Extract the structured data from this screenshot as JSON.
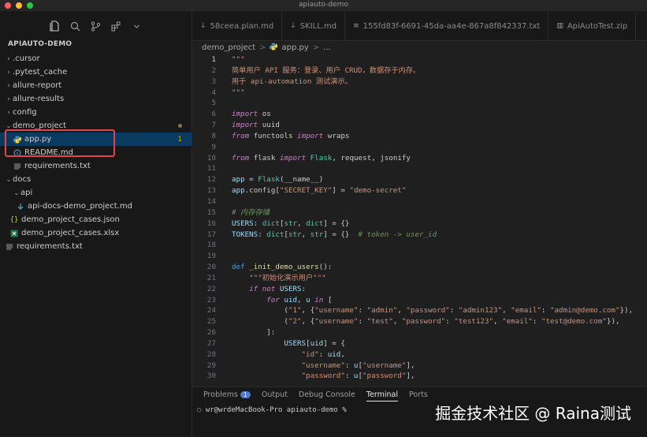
{
  "window": {
    "title": "apiauto-demo"
  },
  "toolbar": {
    "icons": [
      "files-icon",
      "search-icon",
      "source-control-icon",
      "extensions-icon",
      "chevron-down-icon"
    ]
  },
  "sidebar": {
    "project_title": "APIAUTO-DEMO",
    "items": [
      {
        "label": ".cursor",
        "kind": "folder",
        "expanded": false
      },
      {
        "label": ".pytest_cache",
        "kind": "folder",
        "expanded": false
      },
      {
        "label": "allure-report",
        "kind": "folder",
        "expanded": false
      },
      {
        "label": "allure-results",
        "kind": "folder",
        "expanded": false
      },
      {
        "label": "config",
        "kind": "folder",
        "expanded": false
      },
      {
        "label": "demo_project",
        "kind": "folder",
        "expanded": true
      },
      {
        "label": "app.py",
        "kind": "python",
        "badge": "1"
      },
      {
        "label": "README.md",
        "kind": "info"
      },
      {
        "label": "requirements.txt",
        "kind": "text"
      },
      {
        "label": "docs",
        "kind": "folder",
        "expanded": true
      },
      {
        "label": "api",
        "kind": "folder",
        "expanded": true
      },
      {
        "label": "api-docs-demo_project.md",
        "kind": "markdown"
      },
      {
        "label": "demo_project_cases.json",
        "kind": "json"
      },
      {
        "label": "demo_project_cases.xlsx",
        "kind": "excel"
      },
      {
        "label": "requirements.txt",
        "kind": "text"
      }
    ]
  },
  "tabs": [
    {
      "label": "58ceea.plan.md"
    },
    {
      "label": "SKILL.md"
    },
    {
      "label": "155fd83f-6691-45da-aa4e-867a8f842337.txt"
    },
    {
      "label": "ApiAutoTest.zip"
    }
  ],
  "breadcrumb": {
    "folder": "demo_project",
    "sep": ">",
    "file": "app.py",
    "rest": "..."
  },
  "editor": {
    "lines": [
      {
        "n": "1",
        "t": "\"\"\""
      },
      {
        "n": "2",
        "t": "简单用户 API 服务：登录、用户 CRUD，数据存于内存。"
      },
      {
        "n": "3",
        "t": "用于 api-automation 测试演示。"
      },
      {
        "n": "4",
        "t": "\"\"\""
      },
      {
        "n": "5",
        "t": ""
      },
      {
        "n": "6",
        "t": "import os"
      },
      {
        "n": "7",
        "t": "import uuid"
      },
      {
        "n": "8",
        "t": "from functools import wraps"
      },
      {
        "n": "9",
        "t": ""
      },
      {
        "n": "10",
        "t": "from flask import Flask, request, jsonify"
      },
      {
        "n": "11",
        "t": ""
      },
      {
        "n": "12",
        "t": "app = Flask(__name__)"
      },
      {
        "n": "13",
        "t": "app.config[\"SECRET_KEY\"] = \"demo-secret\""
      },
      {
        "n": "14",
        "t": ""
      },
      {
        "n": "15",
        "t": "# 内存存储"
      },
      {
        "n": "16",
        "t": "USERS: dict[str, dict] = {}"
      },
      {
        "n": "17",
        "t": "TOKENS: dict[str, str] = {}  # token -> user_id"
      },
      {
        "n": "18",
        "t": ""
      },
      {
        "n": "19",
        "t": ""
      },
      {
        "n": "20",
        "t": "def _init_demo_users():"
      },
      {
        "n": "21",
        "t": "    \"\"\"初始化演示用户\"\"\""
      },
      {
        "n": "22",
        "t": "    if not USERS:"
      },
      {
        "n": "23",
        "t": "        for uid, u in ["
      },
      {
        "n": "24",
        "t": "            (\"1\", {\"username\": \"admin\", \"password\": \"admin123\", \"email\": \"admin@demo.com\"}),"
      },
      {
        "n": "25",
        "t": "            (\"2\", {\"username\": \"test\", \"password\": \"test123\", \"email\": \"test@demo.com\"}),"
      },
      {
        "n": "26",
        "t": "        ]:"
      },
      {
        "n": "27",
        "t": "            USERS[uid] = {"
      },
      {
        "n": "28",
        "t": "                \"id\": uid,"
      },
      {
        "n": "29",
        "t": "                \"username\": u[\"username\"],"
      },
      {
        "n": "30",
        "t": "                \"password\": u[\"password\"],"
      }
    ]
  },
  "panel": {
    "tabs": [
      {
        "label": "Problems",
        "badge": "1"
      },
      {
        "label": "Output"
      },
      {
        "label": "Debug Console"
      },
      {
        "label": "Terminal",
        "active": true
      },
      {
        "label": "Ports"
      }
    ],
    "prompt": "wr@wrdeMacBook-Pro apiauto-demo %"
  },
  "watermark": "掘金技术社区 @ Raina测试"
}
